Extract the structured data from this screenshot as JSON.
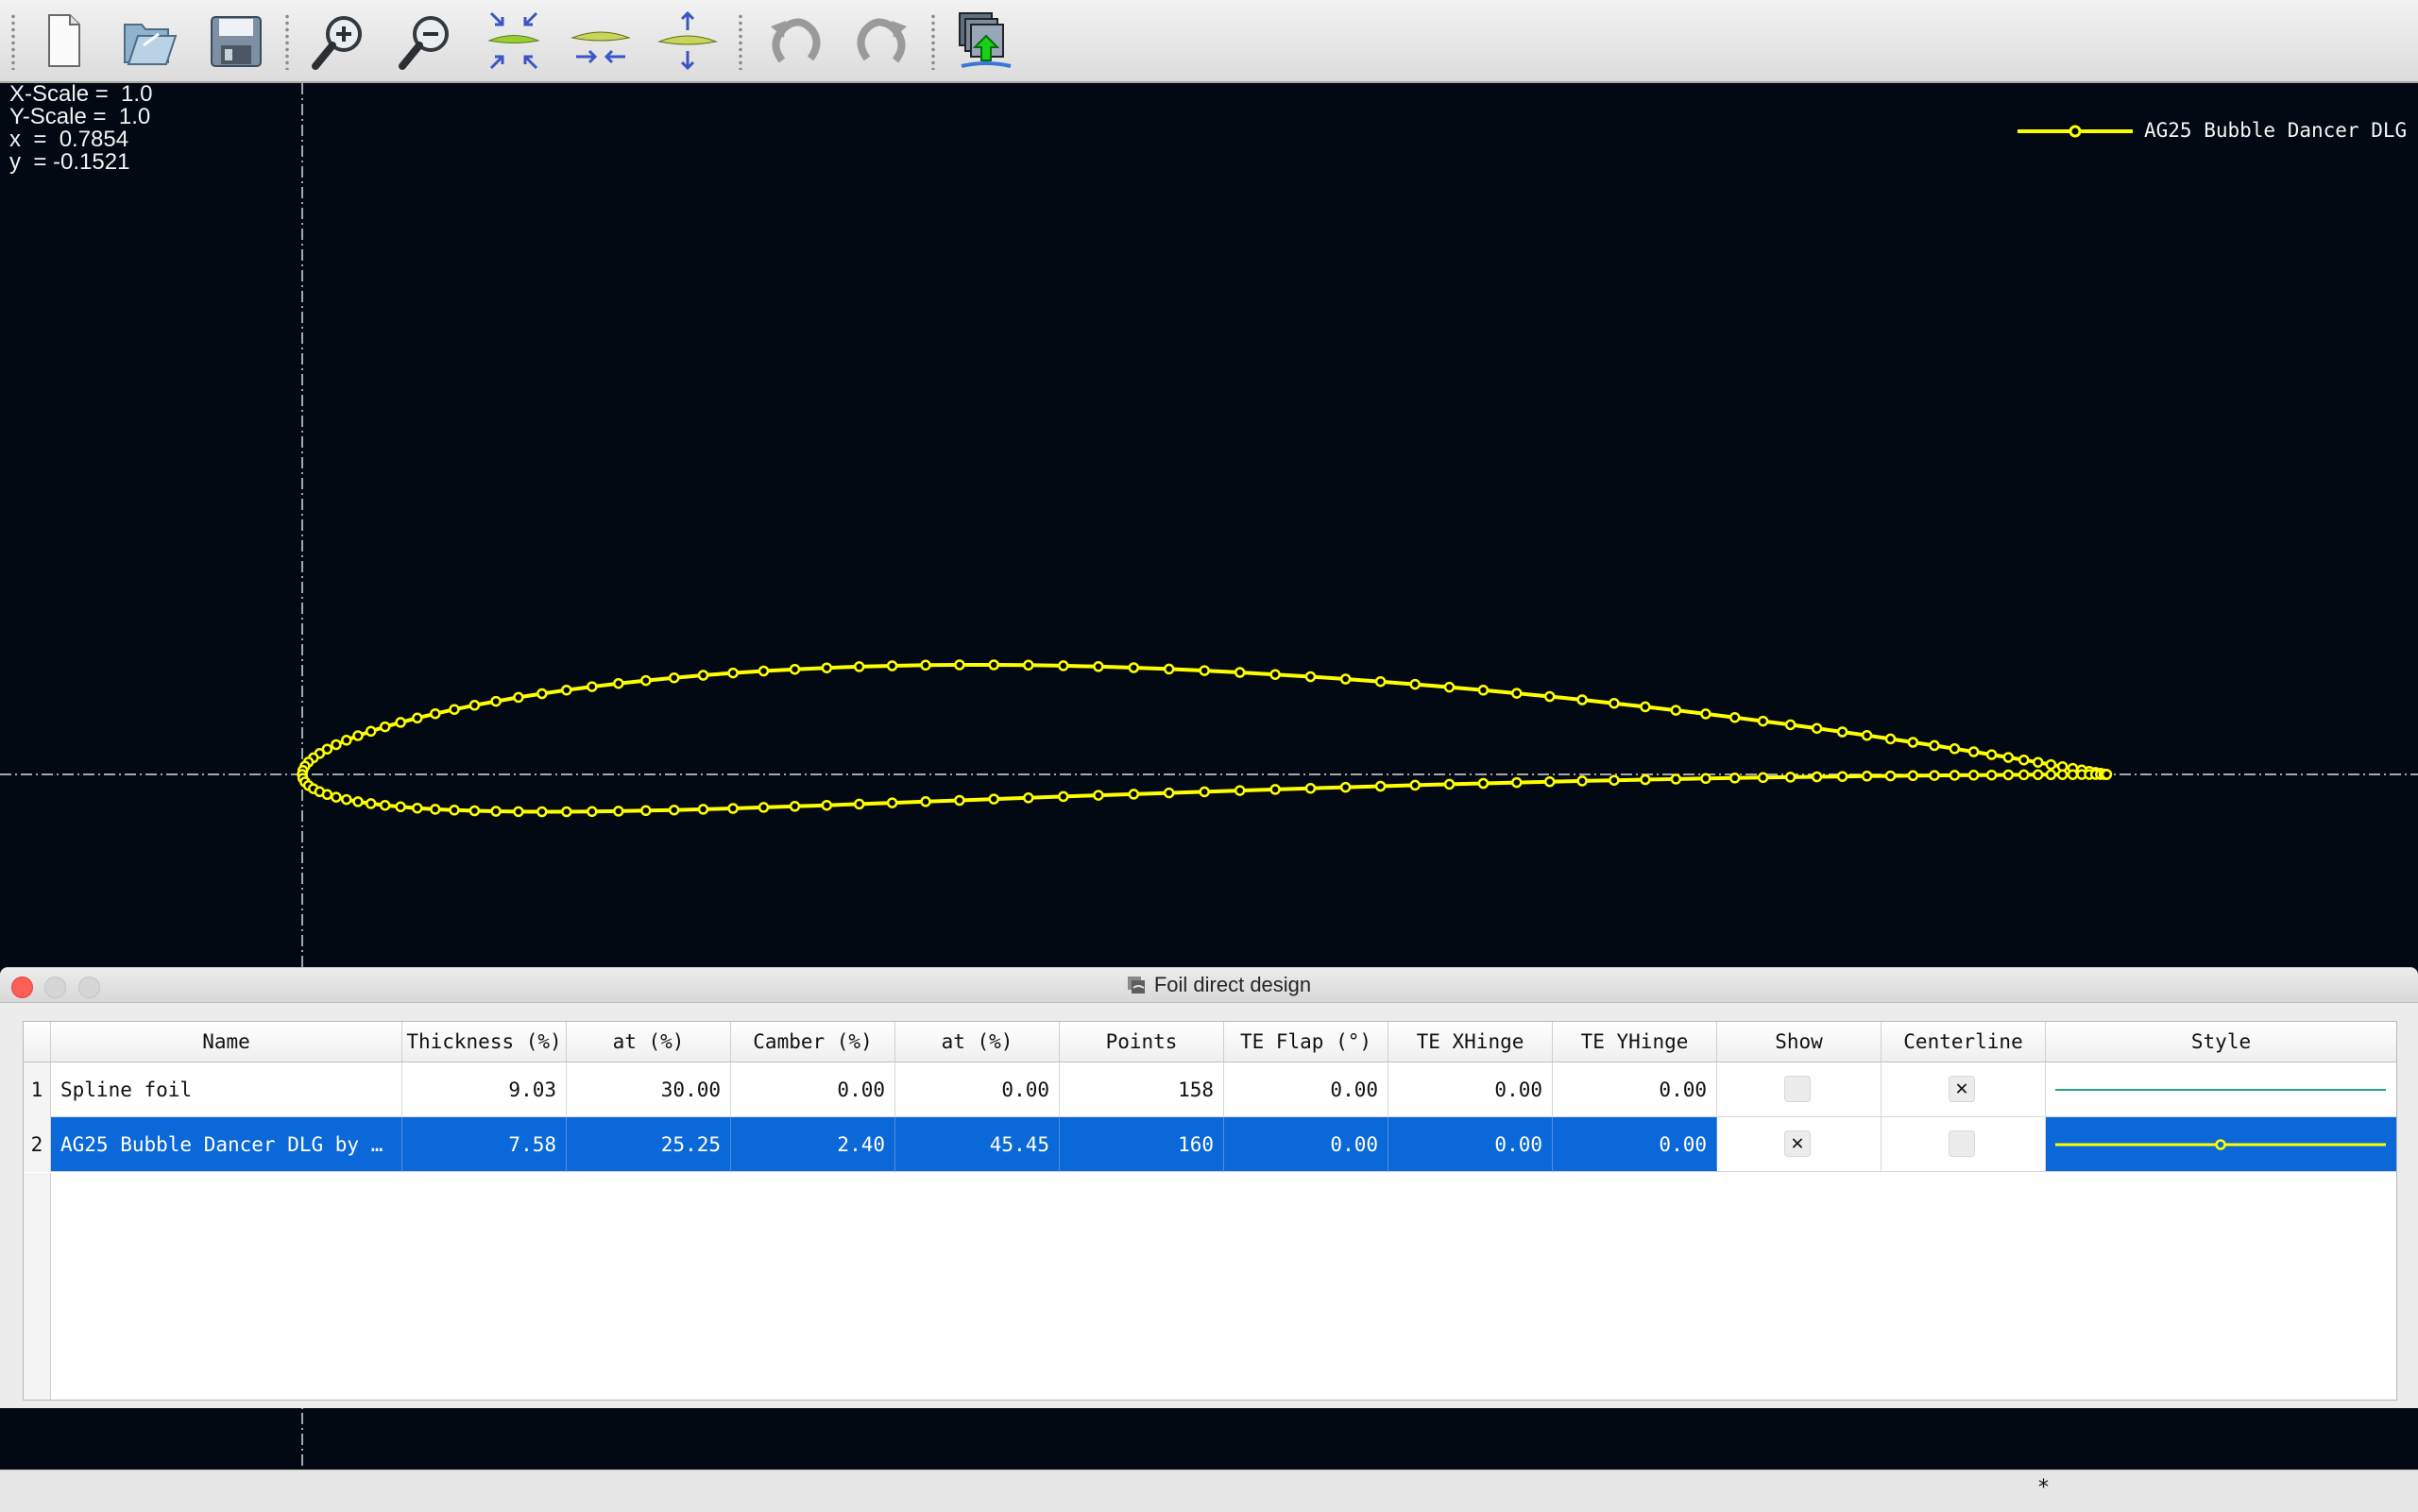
{
  "toolbar": {
    "buttons": [
      {
        "name": "new-file-button",
        "icon": "new-document-icon"
      },
      {
        "name": "open-file-button",
        "icon": "open-folder-icon"
      },
      {
        "name": "save-button",
        "icon": "floppy-disk-icon"
      },
      {
        "name": "zoom-in-button",
        "icon": "zoom-in-icon"
      },
      {
        "name": "zoom-out-button",
        "icon": "zoom-out-icon"
      },
      {
        "name": "reset-scales-button",
        "icon": "reset-scale-icon"
      },
      {
        "name": "x-scale-button",
        "icon": "x-scale-icon"
      },
      {
        "name": "y-scale-button",
        "icon": "y-scale-icon"
      },
      {
        "name": "undo-button",
        "icon": "undo-icon"
      },
      {
        "name": "redo-button",
        "icon": "redo-icon"
      },
      {
        "name": "store-foil-button",
        "icon": "store-foil-icon"
      }
    ]
  },
  "plot": {
    "background": "#020912",
    "foil_color": "#ffff00",
    "axis_color": "#dcdcdc",
    "readout": {
      "xscale": "X-Scale =  1.0",
      "yscale": "Y-Scale =  1.0",
      "x": "x  =  0.7854",
      "y": "y  = -0.1521"
    },
    "legend": {
      "label": "AG25 Bubble Dancer DLG by",
      "color": "#ffff00"
    }
  },
  "dialog": {
    "title": "Foil direct design",
    "title_icon": "foil-design-icon",
    "window_buttons": {
      "close": "#fe5f57",
      "minimize": "#d6d6d6",
      "zoom": "#d6d6d6"
    },
    "columns": [
      "Name",
      "Thickness (%)",
      "at (%)",
      "Camber (%)",
      "at (%)",
      "Points",
      "TE Flap (°)",
      "TE XHinge",
      "TE YHinge",
      "Show",
      "Centerline",
      "Style"
    ],
    "rows": [
      {
        "index": "1",
        "name": "Spline foil",
        "thickness": "9.03",
        "thickness_at": "30.00",
        "camber": "0.00",
        "camber_at": "0.00",
        "points": "158",
        "te_flap": "0.00",
        "te_xhinge": "0.00",
        "te_yhinge": "0.00",
        "show": false,
        "centerline": true,
        "style_color": "#2ca089",
        "selected": false
      },
      {
        "index": "2",
        "name": "AG25 Bubble Dancer DLG by …",
        "thickness": "7.58",
        "thickness_at": "25.25",
        "camber": "2.40",
        "camber_at": "45.45",
        "points": "160",
        "te_flap": "0.00",
        "te_xhinge": "0.00",
        "te_yhinge": "0.00",
        "show": true,
        "centerline": false,
        "style_color": "#ffff00",
        "selected": true
      }
    ],
    "selection_color": "#0b68d8"
  },
  "status": {
    "text": "*"
  }
}
